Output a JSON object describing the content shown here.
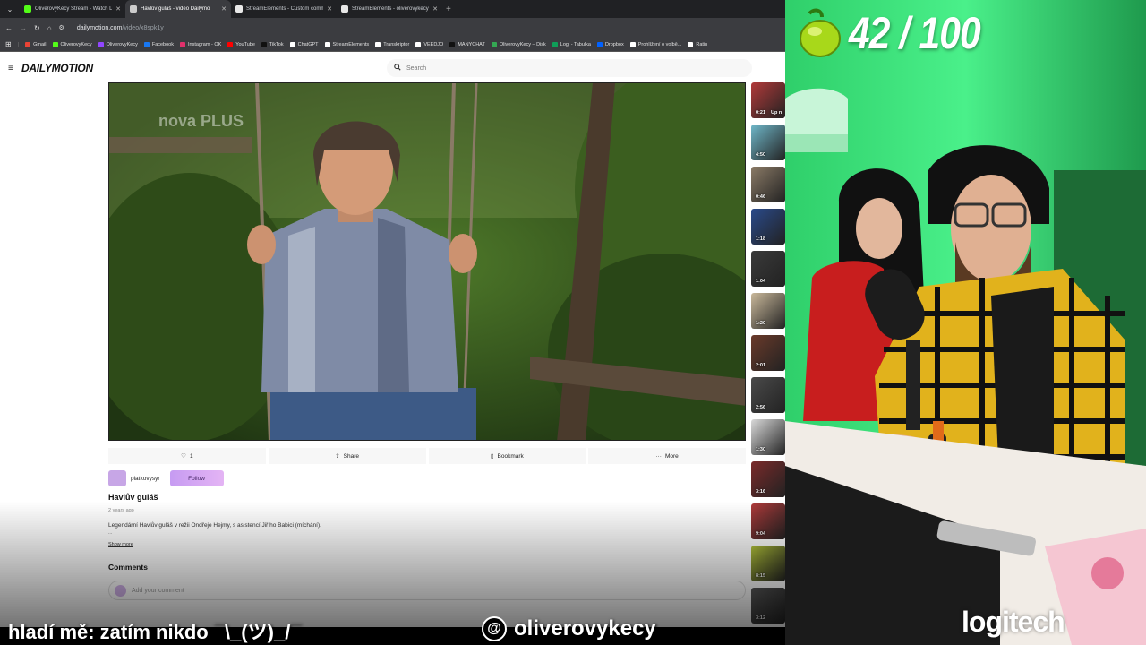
{
  "browser": {
    "tabs": [
      {
        "title": "OliverovyKecy Stream - Watch Li",
        "color": "#53fc18",
        "active": false
      },
      {
        "title": "Havlův guláš - video Dailymo",
        "color": "#cccccc",
        "active": true
      },
      {
        "title": "StreamElements - Custom comm",
        "color": "#e8e8e8",
        "active": false
      },
      {
        "title": "StreamElements - oliverovykecy",
        "color": "#e8e8e8",
        "active": false
      }
    ],
    "new_tab_symbol": "+",
    "url_domain": "dailymotion.com",
    "url_path": "/video/x8spk1y",
    "bookmarks": [
      {
        "label": "Gmail",
        "color": "#ea4335"
      },
      {
        "label": "OliverovyKecy",
        "color": "#53fc18"
      },
      {
        "label": "OliverovyKecy",
        "color": "#9146ff"
      },
      {
        "label": "Facebook",
        "color": "#1877f2"
      },
      {
        "label": "Instagram - OK",
        "color": "#e1306c"
      },
      {
        "label": "YouTube",
        "color": "#ff0000"
      },
      {
        "label": "TikTok",
        "color": "#111111"
      },
      {
        "label": "ChatGPT",
        "color": "#ffffff"
      },
      {
        "label": "StreamElements",
        "color": "#ffffff"
      },
      {
        "label": "Transkriptor",
        "color": "#ffffff"
      },
      {
        "label": "VEEDJO",
        "color": "#ffffff"
      },
      {
        "label": "MANYCHAT",
        "color": "#111111"
      },
      {
        "label": "OliverovyKecy – Disk",
        "color": "#34a853"
      },
      {
        "label": "Logi - Tabulka",
        "color": "#0f9d58"
      },
      {
        "label": "Dropbox",
        "color": "#0061ff"
      },
      {
        "label": "Prohlížení o volbě...",
        "color": "#ffffff"
      },
      {
        "label": "Ratin",
        "color": "#ffffff"
      }
    ]
  },
  "site": {
    "logo": "DAILYMOTION",
    "search_placeholder": "Search"
  },
  "video": {
    "likes": "1",
    "share_label": "Share",
    "bookmark_label": "Bookmark",
    "more_label": "More",
    "channel": "platkovysyr",
    "follow_label": "Follow",
    "title": "Havlův guláš",
    "date": "2 years ago",
    "description": "Legendární Havlův guláš v režii Ondřeje Hejmy, s asistencí Jiřího Babici (míchání).",
    "ellipsis": "...",
    "show_more": "Show more",
    "comments_heading": "Comments",
    "comment_placeholder": "Add your comment",
    "watermark": "nova PLUS"
  },
  "related": [
    {
      "duration": "0:21",
      "extra": "Up n",
      "color": "#b23a3a"
    },
    {
      "duration": "4:50",
      "color": "#6fb7c9"
    },
    {
      "duration": "0:46",
      "color": "#8a7a66"
    },
    {
      "duration": "1:18",
      "color": "#2a4a8a"
    },
    {
      "duration": "1:04",
      "color": "#3a3a3a"
    },
    {
      "duration": "1:20",
      "color": "#c9b89a"
    },
    {
      "duration": "2:01",
      "color": "#6a3a2a"
    },
    {
      "duration": "2:56",
      "color": "#4a4a4a"
    },
    {
      "duration": "1:30",
      "color": "#d9d9d9"
    },
    {
      "duration": "3:16",
      "color": "#7a2a2a"
    },
    {
      "duration": "9:04",
      "color": "#b03a3a"
    },
    {
      "duration": "8:15",
      "color": "#b5c63a"
    },
    {
      "duration": "3:12",
      "color": "#5a5a5a"
    }
  ],
  "overlay": {
    "counter": "42 / 100",
    "ticker": "hladí mě: zatím nikdo ¯\\_(ツ)_/¯",
    "handle": "oliverovykecy",
    "brand": "logitech"
  }
}
